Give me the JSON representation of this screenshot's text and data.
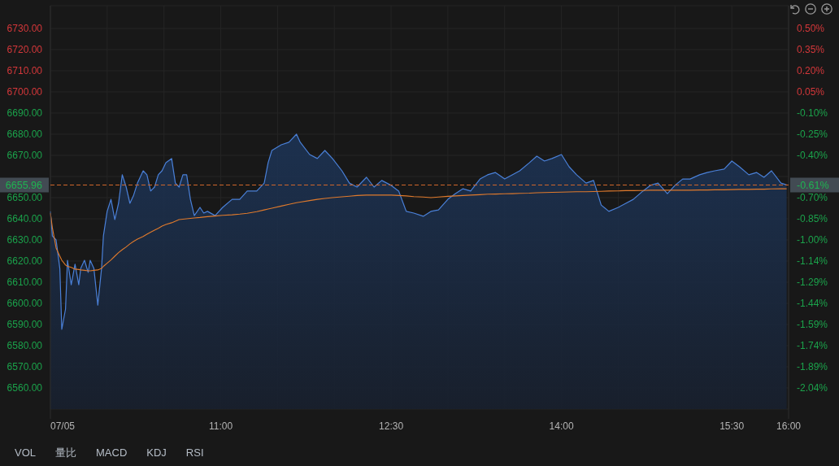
{
  "toolbar": {
    "buttons": [
      {
        "kind": "undo"
      },
      {
        "kind": "zoom_out"
      },
      {
        "kind": "zoom_in"
      }
    ]
  },
  "chart": {
    "date_label": "07/05",
    "chart_data": {
      "type": "area",
      "grid": true,
      "xlim": [
        9.5,
        16
      ],
      "ylim": [
        6550,
        6740
      ],
      "xticks": [
        {
          "value": 11,
          "label": "11:00"
        },
        {
          "value": 12.5,
          "label": "12:30"
        },
        {
          "value": 14,
          "label": "14:00"
        },
        {
          "value": 15.5,
          "label": "15:30"
        },
        {
          "value": 16,
          "label": "16:00"
        }
      ],
      "yticks": [
        {
          "value": 6730,
          "label": "6730.00"
        },
        {
          "value": 6720,
          "label": "6720.00"
        },
        {
          "value": 6710,
          "label": "6710.00"
        },
        {
          "value": 6700,
          "label": "6700.00"
        },
        {
          "value": 6690,
          "label": "6690.00"
        },
        {
          "value": 6680,
          "label": "6680.00"
        },
        {
          "value": 6670,
          "label": "6670.00"
        },
        {
          "value": 6650,
          "label": "6650.00"
        },
        {
          "value": 6640,
          "label": "6640.00"
        },
        {
          "value": 6630,
          "label": "6630.00"
        },
        {
          "value": 6620,
          "label": "6620.00"
        },
        {
          "value": 6610,
          "label": "6610.00"
        },
        {
          "value": 6600,
          "label": "6600.00"
        },
        {
          "value": 6590,
          "label": "6590.00"
        },
        {
          "value": 6580,
          "label": "6580.00"
        },
        {
          "value": 6570,
          "label": "6570.00"
        },
        {
          "value": 6560,
          "label": "6560.00"
        }
      ],
      "x": [
        9.5,
        9.517,
        9.55,
        9.583,
        9.6,
        9.633,
        9.65,
        9.683,
        9.717,
        9.75,
        9.767,
        9.8,
        9.833,
        9.85,
        9.883,
        9.917,
        9.95,
        9.967,
        10,
        10.033,
        10.067,
        10.1,
        10.133,
        10.167,
        10.2,
        10.233,
        10.267,
        10.317,
        10.35,
        10.383,
        10.417,
        10.45,
        10.483,
        10.517,
        10.567,
        10.6,
        10.633,
        10.667,
        10.7,
        10.733,
        10.767,
        10.817,
        10.85,
        10.883,
        10.95,
        11.017,
        11.1,
        11.167,
        11.233,
        11.317,
        11.383,
        11.417,
        11.45,
        11.533,
        11.6,
        11.667,
        11.7,
        11.783,
        11.85,
        11.917,
        11.983,
        12.067,
        12.133,
        12.2,
        12.283,
        12.35,
        12.417,
        12.5,
        12.567,
        12.633,
        12.7,
        12.783,
        12.85,
        12.917,
        13,
        13.067,
        13.133,
        13.2,
        13.283,
        13.35,
        13.417,
        13.5,
        13.567,
        13.633,
        13.717,
        13.783,
        13.85,
        13.917,
        14,
        14.067,
        14.133,
        14.217,
        14.283,
        14.35,
        14.417,
        14.5,
        14.567,
        14.633,
        14.717,
        14.783,
        14.85,
        14.933,
        15,
        15.067,
        15.133,
        15.217,
        15.283,
        15.35,
        15.433,
        15.5,
        15.567,
        15.65,
        15.717,
        15.783,
        15.85,
        15.933,
        15.983
      ],
      "series": [
        {
          "color": "#4a80d8",
          "values": [
            6643.5,
            6631.9,
            6630,
            6616.5,
            6587.7,
            6597.3,
            6620.4,
            6608.8,
            6618.5,
            6608.8,
            6616.5,
            6620.4,
            6614.6,
            6620.4,
            6616.5,
            6599.2,
            6616.5,
            6631.9,
            6643.5,
            6649.2,
            6639.6,
            6647.3,
            6660.8,
            6655,
            6647.3,
            6651.2,
            6656.9,
            6662.7,
            6660.8,
            6653.1,
            6655,
            6660.8,
            6662.7,
            6666.5,
            6668.5,
            6656.9,
            6655,
            6660.8,
            6660.8,
            6649.2,
            6641.5,
            6645.4,
            6642.7,
            6643.5,
            6641.5,
            6645.4,
            6649.2,
            6649.2,
            6653.1,
            6653.1,
            6656.9,
            6666.5,
            6672.3,
            6675,
            6676.2,
            6680,
            6676.2,
            6670.4,
            6668.5,
            6672.3,
            6668.5,
            6662.7,
            6656.9,
            6655,
            6659.6,
            6655,
            6658.1,
            6655.8,
            6653.1,
            6643.5,
            6642.7,
            6641.2,
            6643.5,
            6644.2,
            6649.2,
            6651.9,
            6654.2,
            6653.1,
            6658.8,
            6660.8,
            6661.9,
            6658.8,
            6660.8,
            6662.7,
            6666.5,
            6669.6,
            6667.3,
            6668.5,
            6670.4,
            6664.6,
            6660.8,
            6656.9,
            6658.1,
            6646.5,
            6643.5,
            6645.4,
            6647.3,
            6649.2,
            6653.1,
            6655.8,
            6656.9,
            6651.9,
            6655.8,
            6658.8,
            6658.8,
            6660.8,
            6661.9,
            6662.7,
            6663.5,
            6667.3,
            6664.6,
            6660.8,
            6661.9,
            6659.6,
            6662.7,
            6656.9,
            6656
          ]
        },
        {
          "type": "line",
          "color": "#e07a2c",
          "values": [
            6642.7,
            6635.8,
            6626.2,
            6622.3,
            6620.4,
            6618.1,
            6617.5,
            6617,
            6616.2,
            6616,
            6615.8,
            6615.6,
            6615.4,
            6615.4,
            6615.6,
            6615.8,
            6616.5,
            6617.5,
            6619,
            6620.5,
            6622.3,
            6624,
            6625.4,
            6626.7,
            6628.1,
            6629.3,
            6630.4,
            6631.6,
            6632.7,
            6633.7,
            6634.6,
            6635.5,
            6636.5,
            6637.3,
            6638.1,
            6638.9,
            6639.6,
            6639.8,
            6640,
            6640.2,
            6640.4,
            6640.6,
            6640.8,
            6641,
            6641.3,
            6641.6,
            6641.9,
            6642.2,
            6642.6,
            6643.4,
            6644.2,
            6644.6,
            6645,
            6646,
            6646.8,
            6647.6,
            6647.9,
            6648.6,
            6649.2,
            6649.6,
            6650,
            6650.4,
            6650.7,
            6651,
            6651.2,
            6651.2,
            6651.2,
            6651.2,
            6651,
            6650.8,
            6650.5,
            6650.3,
            6650,
            6650.3,
            6650.6,
            6650.8,
            6651,
            6651.2,
            6651.4,
            6651.6,
            6651.7,
            6651.8,
            6651.9,
            6652,
            6652.1,
            6652.3,
            6652.4,
            6652.5,
            6652.6,
            6652.7,
            6652.8,
            6652.8,
            6652.9,
            6653,
            6653.1,
            6653.2,
            6653.3,
            6653.3,
            6653.4,
            6653.5,
            6653.5,
            6653.5,
            6653.5,
            6653.5,
            6653.5,
            6653.6,
            6653.6,
            6653.7,
            6653.7,
            6653.8,
            6653.9,
            6653.9,
            6654,
            6654,
            6654.1,
            6654.2,
            6654.2
          ]
        }
      ],
      "ref_lines": [
        {
          "axis": "y",
          "value": 6655.96,
          "label": "6655.96"
        }
      ]
    },
    "price_axis": [
      {
        "color": "#d4373a"
      },
      {
        "color": "#d4373a"
      },
      {
        "color": "#d4373a"
      },
      {
        "color": "#d4373a"
      },
      {
        "color": "#1ba24b"
      },
      {
        "color": "#1ba24b"
      },
      {
        "color": "#1ba24b"
      },
      {
        "color": "#1ba24b"
      },
      {
        "color": "#1ba24b"
      },
      {
        "color": "#1ba24b"
      },
      {
        "color": "#1ba24b"
      },
      {
        "color": "#1ba24b"
      },
      {
        "color": "#1ba24b"
      },
      {
        "color": "#1ba24b"
      },
      {
        "color": "#1ba24b"
      },
      {
        "color": "#1ba24b"
      },
      {
        "color": "#1ba24b"
      }
    ],
    "percent_axis": [
      {
        "label": "0.50%",
        "color": "#d4373a"
      },
      {
        "label": "0.35%",
        "color": "#d4373a"
      },
      {
        "label": "0.20%",
        "color": "#d4373a"
      },
      {
        "label": "0.05%",
        "color": "#d4373a"
      },
      {
        "label": "-0.10%",
        "color": "#1ba24b"
      },
      {
        "label": "-0.25%",
        "color": "#1ba24b"
      },
      {
        "label": "-0.40%",
        "color": "#1ba24b"
      },
      {
        "label": "-0.70%",
        "color": "#1ba24b"
      },
      {
        "label": "-0.85%",
        "color": "#1ba24b"
      },
      {
        "label": "-1.00%",
        "color": "#1ba24b"
      },
      {
        "label": "-1.14%",
        "color": "#1ba24b"
      },
      {
        "label": "-1.29%",
        "color": "#1ba24b"
      },
      {
        "label": "-1.44%",
        "color": "#1ba24b"
      },
      {
        "label": "-1.59%",
        "color": "#1ba24b"
      },
      {
        "label": "-1.74%",
        "color": "#1ba24b"
      },
      {
        "label": "-1.89%",
        "color": "#1ba24b"
      },
      {
        "label": "-2.04%",
        "color": "#1ba24b"
      }
    ],
    "last_price": {
      "change": "-0.61%"
    }
  },
  "indicator_tabs": [
    "VOL",
    "量比",
    "MACD",
    "KDJ",
    "RSI"
  ]
}
